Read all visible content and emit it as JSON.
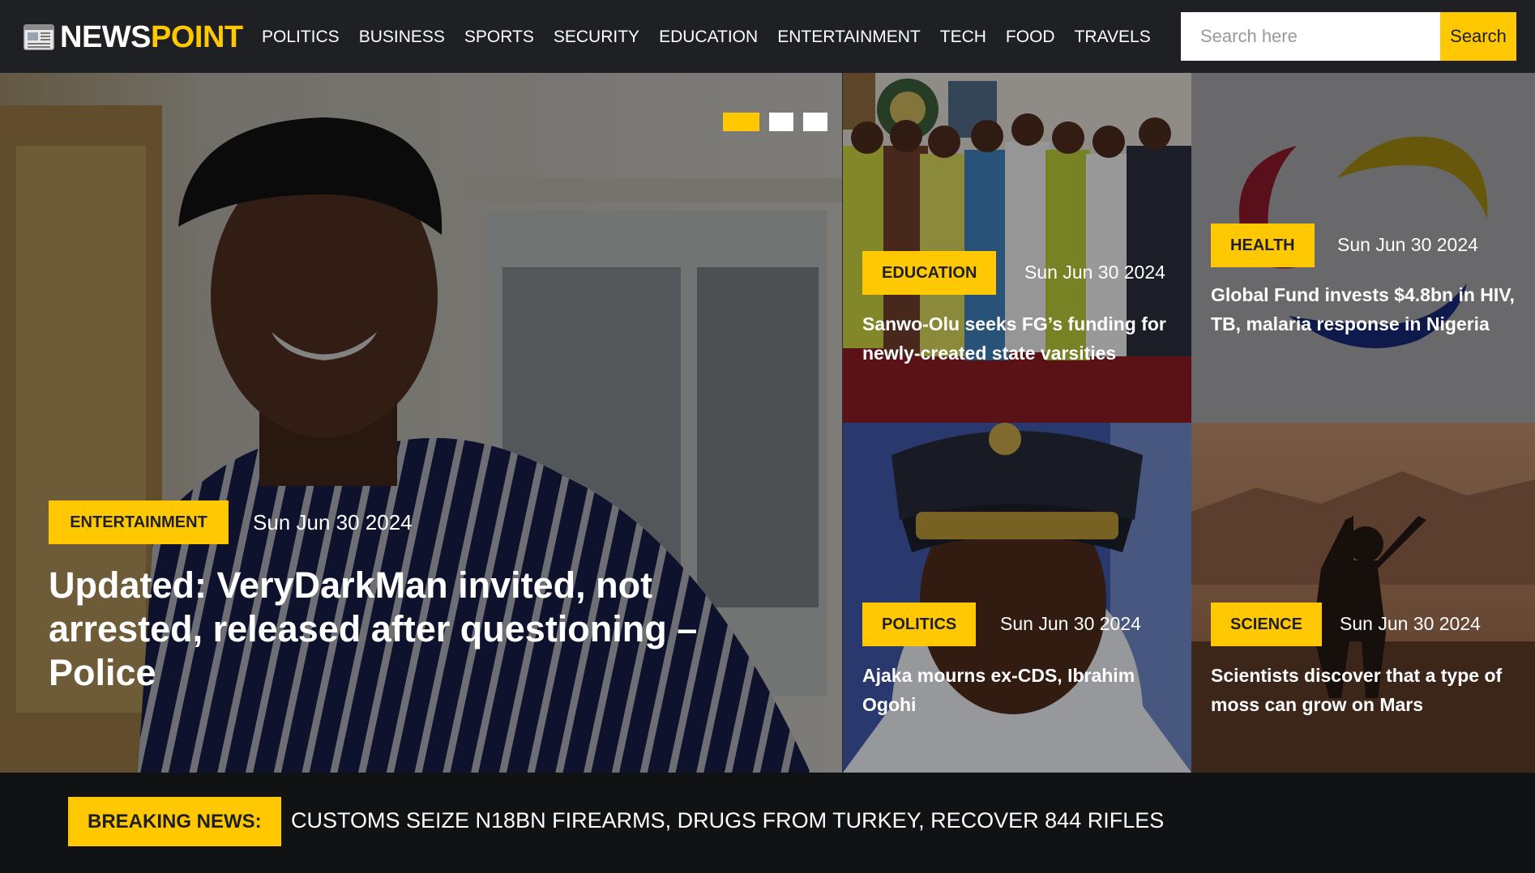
{
  "brand": {
    "name_part1": "NEWS",
    "name_part2": "POINT",
    "accent_color": "#ffc800",
    "logo_icon": "newspaper-icon"
  },
  "nav": {
    "items": [
      "POLITICS",
      "BUSINESS",
      "SPORTS",
      "SECURITY",
      "EDUCATION",
      "ENTERTAINMENT",
      "TECH",
      "FOOD",
      "TRAVELS"
    ]
  },
  "search": {
    "placeholder": "Search here",
    "value": "",
    "button_label": "Search"
  },
  "carousel": {
    "slide_count": 3,
    "active_index": 0
  },
  "main_story": {
    "category": "ENTERTAINMENT",
    "date": "Sun Jun 30 2024",
    "headline": "Updated: VeryDarkMan invited, not arrested, released after questioning – Police"
  },
  "side_stories": [
    {
      "category": "EDUCATION",
      "date": "Sun Jun 30 2024",
      "headline": "Sanwo-Olu seeks FG’s funding for newly-created state varsities"
    },
    {
      "category": "HEALTH",
      "date": "Sun Jun 30 2024",
      "headline": "Global Fund invests $4.8bn in HIV, TB, malaria response in Nigeria"
    },
    {
      "category": "POLITICS",
      "date": "Sun Jun 30 2024",
      "headline": "Ajaka mourns ex-CDS, Ibrahim Ogohi"
    },
    {
      "category": "SCIENCE",
      "date": "Sun Jun 30 2024",
      "headline": "Scientists discover that a type of moss can grow on Mars"
    }
  ],
  "breaking_news": {
    "label": "BREAKING NEWS:",
    "text": "CUSTOMS SEIZE N18BN FIREARMS, DRUGS FROM TURKEY, RECOVER 844 RIFLES"
  }
}
